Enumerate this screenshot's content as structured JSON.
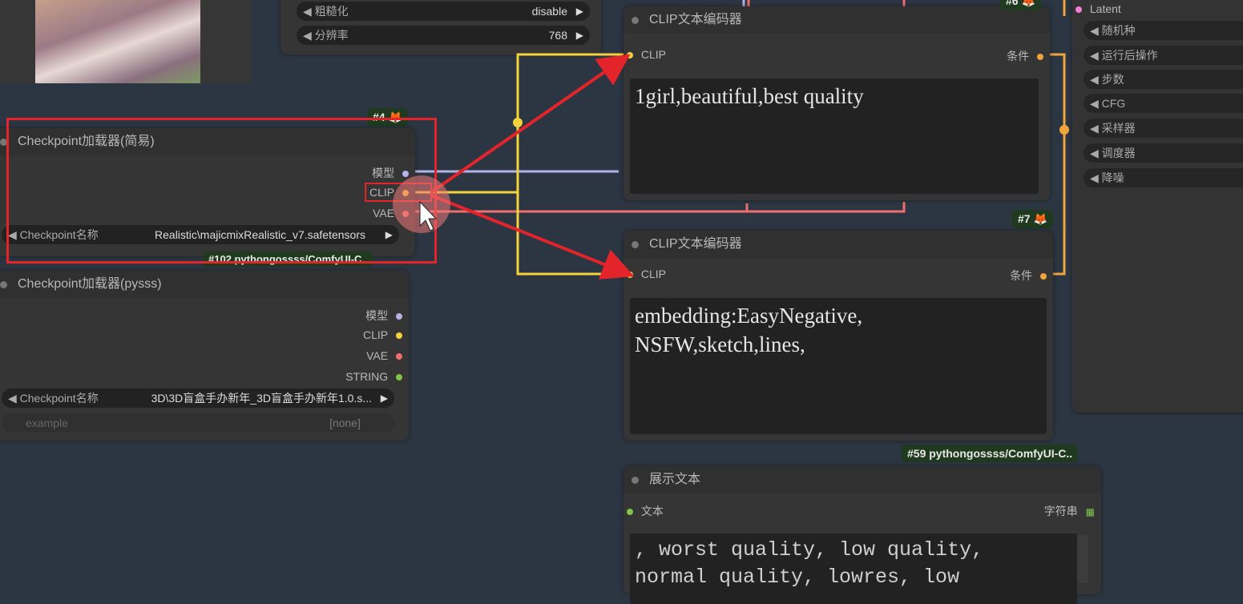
{
  "top_widgets": [
    {
      "label": "◀ 粗糙化",
      "value": "disable",
      "arrow": "▶"
    },
    {
      "label": "◀ 分辨率",
      "value": "768",
      "arrow": "▶"
    }
  ],
  "clip_node_1": {
    "title": "CLIP文本编码器",
    "input": "CLIP",
    "output": "条件",
    "text": "1girl,beautiful,best quality"
  },
  "clip_node_2": {
    "title": "CLIP文本编码器",
    "badge": "#7",
    "input": "CLIP",
    "output": "条件",
    "text": "embedding:EasyNegative,\nNSFW,sketch,lines,"
  },
  "ckpt_simple": {
    "badge": "#4",
    "title": "Checkpoint加载器(简易)",
    "outputs": [
      "模型",
      "CLIP",
      "VAE"
    ],
    "widget_label": "◀ Checkpoint名称",
    "widget_value": "Realistic\\majicmixRealistic_v7.safetensors",
    "widget_arrow": "▶",
    "footer_badge": "#102 pythongossss/ComfyUI-C.."
  },
  "ckpt_pysss": {
    "title": "Checkpoint加载器(pysss)",
    "outputs": [
      "模型",
      "CLIP",
      "VAE",
      "STRING"
    ],
    "widget_label": "◀ Checkpoint名称",
    "widget_value": "3D\\3D盲盒手办新年_3D盲盒手办新年1.0.s...",
    "widget_arrow": "▶",
    "example_label": "example",
    "example_value": "[none]"
  },
  "show_text": {
    "badge": "#59 pythongossss/ComfyUI-C..",
    "title": "展示文本",
    "input": "文本",
    "output": "字符串",
    "text": ", worst quality, low quality,\nnormal quality, lowres, low"
  },
  "sampler": {
    "latent": "Latent",
    "items": [
      "◀ 随机种",
      "◀ 运行后操作",
      "◀ 步数",
      "◀ CFG",
      "◀ 采样器",
      "◀ 调度器",
      "◀ 降噪"
    ]
  },
  "badge_top": "#6",
  "colors": {
    "model": "#b3b3e8",
    "clip": "#f3d23c",
    "vae": "#ef6f6f",
    "string": "#7fc64a",
    "latent": "#f47ed9",
    "annotation": "#e3242b"
  }
}
